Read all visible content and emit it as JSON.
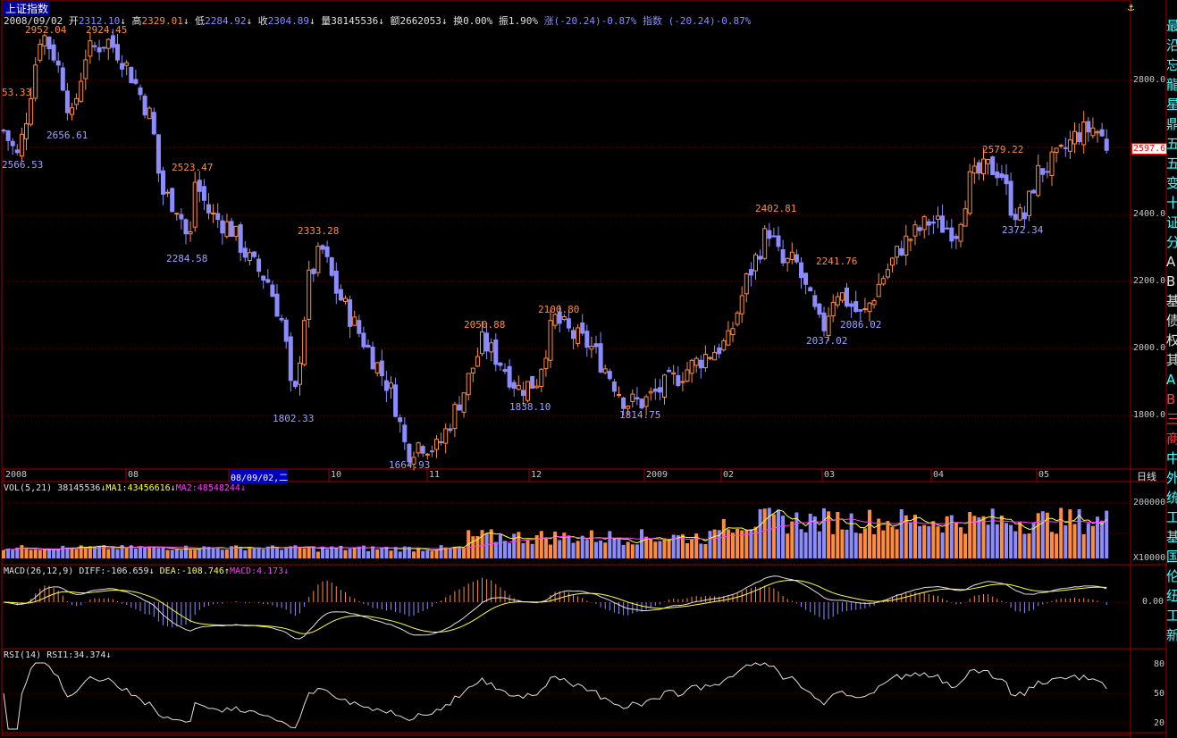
{
  "title": "上证指数",
  "header": {
    "date": "2008/09/02",
    "open_label": "开",
    "open": "2312.10",
    "high_label": "高",
    "high": "2329.01",
    "low_label": "低",
    "low": "2284.92",
    "close_label": "收",
    "close": "2304.89",
    "vol_label": "量",
    "vol": "38145536",
    "amt_label": "额",
    "amt": "2662053",
    "turn_label": "换",
    "turn": "0.00%",
    "amp_label": "振",
    "amp": "1.90%",
    "chg_label": "涨",
    "chg": "(-20.24)-0.87%",
    "idx_label": "指数",
    "idx": "(-20.24)-0.87%"
  },
  "price_axis": [
    "2800.0",
    "2600.0",
    "2400.0",
    "2200.0",
    "2000.0",
    "1800.0"
  ],
  "current_price": "2597.6",
  "time_axis": [
    "2008",
    "08",
    "08/09/02,二",
    "10",
    "11",
    "12",
    "2009",
    "02",
    "03",
    "04",
    "05"
  ],
  "period_label": "日线",
  "annotations": [
    {
      "text": "2952.04",
      "kind": "high"
    },
    {
      "text": "2924.45",
      "kind": "high"
    },
    {
      "text": "53.33",
      "kind": "high"
    },
    {
      "text": "2656.61",
      "kind": "low"
    },
    {
      "text": "2566.53",
      "kind": "low"
    },
    {
      "text": "2523.47",
      "kind": "high"
    },
    {
      "text": "2284.58",
      "kind": "low"
    },
    {
      "text": "2333.28",
      "kind": "high"
    },
    {
      "text": "1802.33",
      "kind": "low"
    },
    {
      "text": "1664.93",
      "kind": "low"
    },
    {
      "text": "2050.88",
      "kind": "high"
    },
    {
      "text": "1838.10",
      "kind": "low"
    },
    {
      "text": "2100.80",
      "kind": "high"
    },
    {
      "text": "1814.75",
      "kind": "low"
    },
    {
      "text": "2402.81",
      "kind": "high"
    },
    {
      "text": "2241.76",
      "kind": "high"
    },
    {
      "text": "2037.02",
      "kind": "low"
    },
    {
      "text": "2086.02",
      "kind": "low"
    },
    {
      "text": "2579.22",
      "kind": "high"
    },
    {
      "text": "2372.34",
      "kind": "low"
    }
  ],
  "vol_panel": {
    "label": "VOL(5,21)",
    "value": "38145536",
    "ma1_label": "MA1:43456616",
    "ma2_label": "MA2:48548244",
    "axis_top": "200000",
    "axis_unit": "X10000"
  },
  "macd_panel": {
    "label": "MACD(26,12,9)",
    "diff": "DIFF:-106.659",
    "dea": "DEA:-108.746",
    "macd": "MACD:4.173",
    "axis_zero": "0.00"
  },
  "rsi_panel": {
    "label": "RSI(14)",
    "value": "RSI1:34.374",
    "axis": [
      "80",
      "50",
      "20"
    ]
  },
  "right_column": [
    "最",
    "沿",
    "忘",
    "龍",
    "星",
    "鼎",
    "五",
    "五",
    "变",
    "十",
    "证",
    "分",
    "A",
    "B",
    "基",
    "债",
    "权",
    "其",
    "A",
    "B",
    "三",
    "商",
    "中",
    "外",
    "统",
    "工",
    "基",
    "国",
    "伦",
    "纽",
    "工",
    "新"
  ],
  "colors": {
    "up": "#ff8c3c",
    "down": "#8c8cff",
    "ma1": "#ffff3c",
    "ma2": "#ff3cff",
    "grid": "#800000"
  }
}
